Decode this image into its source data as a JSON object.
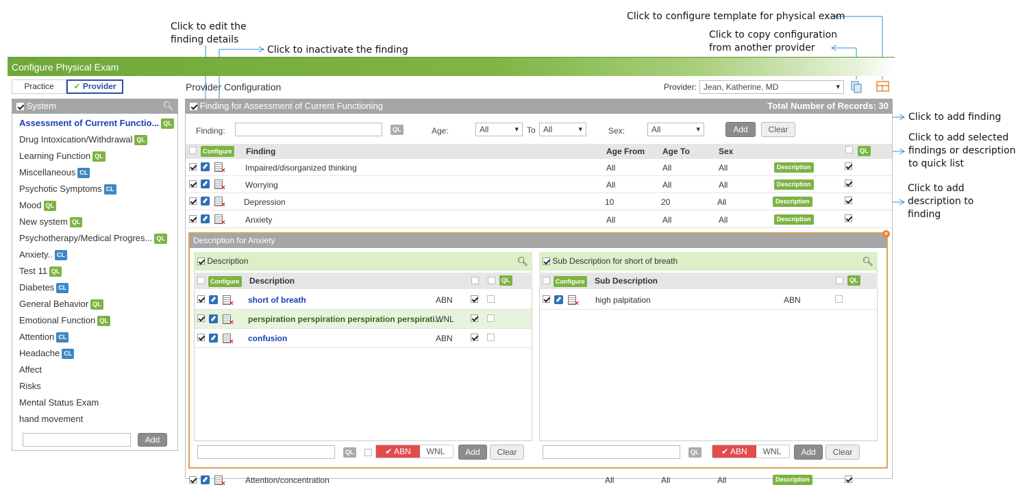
{
  "annotations": {
    "edit_finding": "Click to edit the\nfinding details",
    "inactivate_finding": "Click to inactivate the finding",
    "configure_template": "Click to configure template for physical exam",
    "copy_config": "Click to copy configuration\nfrom another provider",
    "add_finding": "Click to add finding",
    "add_quicklist": "Click to add selected\nfindings or description\nto quick list",
    "add_description": "Click to add\ndescription to\nfinding"
  },
  "title": "Configure Physical Exam",
  "mode_tabs": {
    "practice": "Practice",
    "provider": "Provider"
  },
  "provider_config_label": "Provider Configuration",
  "provider_label": "Provider:",
  "provider_value": "Jean, Katherine, MD",
  "system_panel": {
    "header": "System",
    "items": [
      {
        "label": "Assessment of Current Functio...",
        "ql": "QL",
        "ql_color": "#7cb342"
      },
      {
        "label": "Drug Intoxication/Withdrawal",
        "ql": "QL",
        "ql_color": "#7cb342"
      },
      {
        "label": "Learning Function",
        "ql": "QL",
        "ql_color": "#7cb342"
      },
      {
        "label": "Miscellaneous",
        "ql": "CL",
        "ql_color": "#3d87c4"
      },
      {
        "label": "Psychotic Symptoms",
        "ql": "CL",
        "ql_color": "#3d87c4"
      },
      {
        "label": "Mood",
        "ql": "QL",
        "ql_color": "#7cb342"
      },
      {
        "label": "New system",
        "ql": "QL",
        "ql_color": "#7cb342"
      },
      {
        "label": "Psychotherapy/Medical Progres...",
        "ql": "QL",
        "ql_color": "#7cb342"
      },
      {
        "label": "Anxiety..",
        "ql": "CL",
        "ql_color": "#3d87c4"
      },
      {
        "label": "Test 11",
        "ql": "QL",
        "ql_color": "#7cb342"
      },
      {
        "label": "Diabetes",
        "ql": "CL",
        "ql_color": "#3d87c4"
      },
      {
        "label": "General Behavior",
        "ql": "QL",
        "ql_color": "#7cb342"
      },
      {
        "label": "Emotional Function",
        "ql": "QL",
        "ql_color": "#7cb342"
      },
      {
        "label": "Attention",
        "ql": "CL",
        "ql_color": "#3d87c4"
      },
      {
        "label": "Headache",
        "ql": "CL",
        "ql_color": "#3d87c4"
      },
      {
        "label": "Affect",
        "ql": "",
        "ql_color": ""
      },
      {
        "label": "Risks",
        "ql": "",
        "ql_color": ""
      },
      {
        "label": "Mental Status Exam",
        "ql": "",
        "ql_color": ""
      },
      {
        "label": "hand movement",
        "ql": "",
        "ql_color": ""
      }
    ],
    "add_label": "Add"
  },
  "finding_panel": {
    "header": "Finding for Assessment of Current Functioning",
    "total_records": "Total Number of Records: 30",
    "finding_label": "Finding:",
    "ql": "QL",
    "age_label": "Age:",
    "age_from": "All",
    "to_label": "To",
    "age_to": "All",
    "sex_label": "Sex:",
    "sex_value": "All",
    "add_label": "Add",
    "clear_label": "Clear",
    "columns": {
      "configure": "Configure",
      "finding": "Finding",
      "age_from": "Age From",
      "age_to": "Age To",
      "sex": "Sex"
    },
    "rows": [
      {
        "finding": "Impaired/disorganized thinking",
        "age_from": "All",
        "age_to": "All",
        "sex": "All",
        "btn": "Description"
      },
      {
        "finding": "Worrying",
        "age_from": "All",
        "age_to": "All",
        "sex": "All",
        "btn": "Description"
      },
      {
        "finding": "Depression",
        "age_from": "10",
        "age_to": "20",
        "sex": "All",
        "btn": "Description"
      },
      {
        "finding": "Anxiety",
        "age_from": "All",
        "age_to": "All",
        "sex": "All",
        "btn": "Description"
      }
    ],
    "last_row": {
      "finding": "Attention/concentration",
      "age_from": "All",
      "age_to": "All",
      "sex": "All",
      "btn": "Description"
    }
  },
  "desc_section": {
    "header": "Description for Anxiety",
    "left": {
      "header": "Description",
      "col_configure": "Configure",
      "col_desc": "Description",
      "ql": "QL",
      "rows": [
        {
          "text": "short of breath",
          "type": "ABN"
        },
        {
          "text": "perspiration perspiration perspiration perspirati...",
          "type": "WNL"
        },
        {
          "text": "confusion",
          "type": "ABN"
        }
      ],
      "abn": "ABN",
      "wnl": "WNL",
      "add": "Add",
      "clear": "Clear"
    },
    "right": {
      "header": "Sub Description for short of breath",
      "col_configure": "Configure",
      "col_desc": "Sub Description",
      "ql": "QL",
      "rows": [
        {
          "text": "high palpitation",
          "type": "ABN"
        }
      ],
      "abn": "ABN",
      "wnl": "WNL",
      "add": "Add",
      "clear": "Clear"
    }
  },
  "colors": {
    "brand_green": "#7cb342",
    "header_gray": "#a6a6a6",
    "link_blue": "#1a3fb5",
    "dark_green_text": "#2e6b12",
    "orange_border": "#e0a050",
    "abn_red": "#e24c4c"
  }
}
